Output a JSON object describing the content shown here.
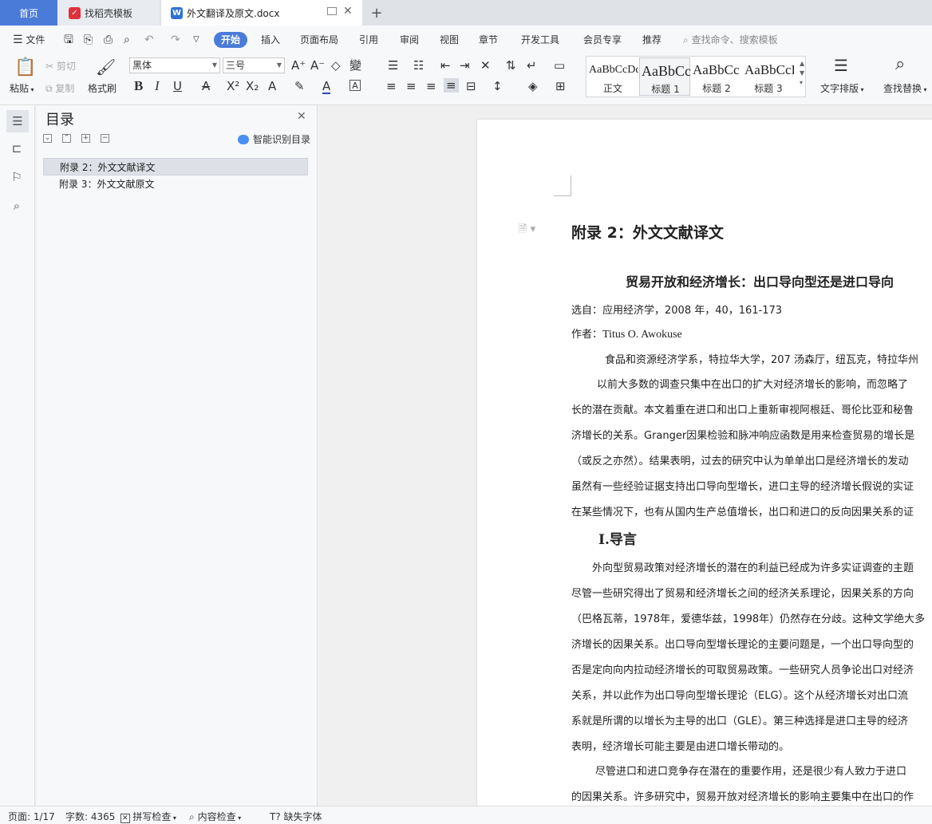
{
  "tabs": {
    "home": "首页",
    "template": "找稻壳模板",
    "doc": "外文翻译及原文.docx"
  },
  "menu": {
    "file": "文件",
    "items": [
      "开始",
      "插入",
      "页面布局",
      "引用",
      "审阅",
      "视图",
      "章节",
      "开发工具",
      "会员专享",
      "推荐"
    ],
    "search_placeholder": "查找命令、搜索模板"
  },
  "ribbon": {
    "paste": "粘贴",
    "cut": "剪切",
    "copy": "复制",
    "format_painter": "格式刷",
    "font_name": "黑体",
    "font_size": "三号",
    "styles": [
      {
        "sample": "AaBbCcDd",
        "name": "正文"
      },
      {
        "sample": "AaBbCc",
        "name": "标题 1"
      },
      {
        "sample": "AaBbCc",
        "name": "标题 2"
      },
      {
        "sample": "AaBbCcI",
        "name": "标题 3"
      }
    ],
    "text_layout": "文字排版",
    "find_replace": "查找替换"
  },
  "toc": {
    "title": "目录",
    "smart_identify": "智能识别目录",
    "items": [
      "附录 2：外文文献译文",
      "附录 3：外文文献原文"
    ]
  },
  "doc": {
    "heading": "附录 2：外文文献译文",
    "title": "贸易开放和经济增长：出口导向型还是进口导向",
    "source": "选自：应用经济学，2008 年，40，161-173",
    "author_label": "作者：",
    "author": "Titus O. Awokuse",
    "affiliation": "食品和资源经济学系，特拉华大学，207 汤森厅，纽瓦克，特拉华州",
    "abstract": [
      "以前大多数的调查只集中在出口的扩大对经济增长的影响，而忽略了",
      "长的潜在贡献。本文着重在进口和出口上重新审视阿根廷、哥伦比亚和秘鲁",
      "济增长的关系。Granger因果检验和脉冲响应函数是用来检查贸易的增长是",
      "（或反之亦然）。结果表明，过去的研究中认为单单出口是经济增长的发动",
      "虽然有一些经验证据支持出口导向型增长，进口主导的经济增长假说的实证",
      "在某些情况下，也有从国内生产总值增长，出口和进口的反向因果关系的证"
    ],
    "section1": "Ⅰ.导言",
    "body": [
      "外向型贸易政策对经济增长的潜在的利益已经成为许多实证调查的主题",
      "尽管一些研究得出了贸易和经济增长之间的经济关系理论，因果关系的方向",
      "（巴格瓦蒂，1978年，爱德华兹，1998年）仍然存在分歧。这种文学绝大多",
      "济增长的因果关系。出口导向型增长理论的主要问题是，一个出口导向型的",
      "否是定向向内拉动经济增长的可取贸易政策。一些研究人员争论出口对经济",
      "关系，并以此作为出口导向型增长理论（ELG）。这个从经济增长对出口流",
      "系就是所谓的以增长为主导的出口（GLE）。第三种选择是进口主导的经济",
      "表明，经济增长可能主要是由进口增长带动的。",
      "尽管进口和进口竞争存在潜在的重要作用，还是很少有人致力于进口",
      "的因果关系。许多研究中，贸易开放对经济增长的影响主要集中在出口的作"
    ]
  },
  "status": {
    "page": "页面: 1/17",
    "words": "字数: 4365",
    "spell": "拼写检查",
    "content": "内容检查",
    "missing_font": "缺失字体"
  },
  "colors": {
    "accent": "#4a7bd8",
    "font_color_bar": "#2b44c8"
  }
}
